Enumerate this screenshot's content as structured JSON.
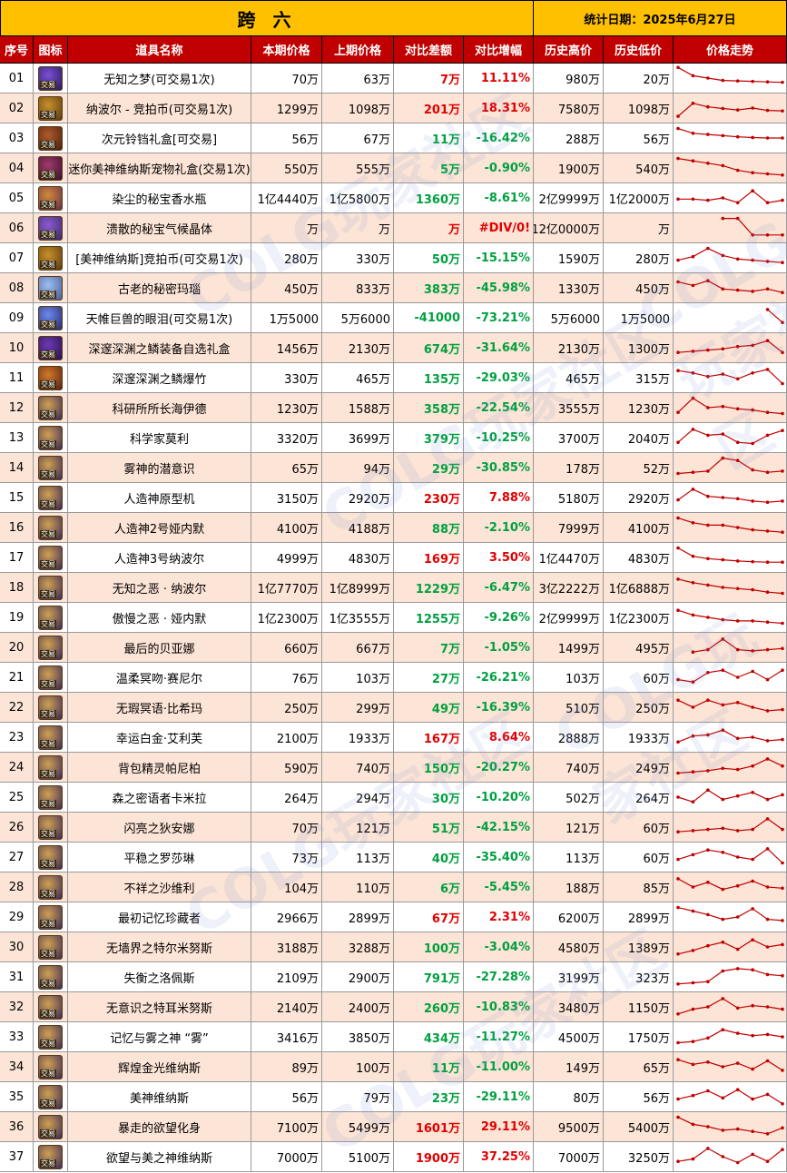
{
  "title": "跨 六",
  "stat_date": "统计日期：2025年6月27日",
  "columns": [
    "序号",
    "图标",
    "道具名称",
    "本期价格",
    "上期价格",
    "对比差额",
    "对比增幅",
    "历史高价",
    "历史低价",
    "价格走势"
  ],
  "watermark": "COLG玩家社区",
  "colors": {
    "header_yellow": "#ffc000",
    "header_red": "#c00000",
    "row_alt": "#fce4d6",
    "positive": "#e00000",
    "negative": "#00a040",
    "trend": "#c00000"
  },
  "rows": [
    {
      "no": "01",
      "icon": "purple-orb",
      "name": "无知之梦(可交易1次)",
      "cur": "70万",
      "prev": "63万",
      "diff": "7万",
      "pct": "11.11%",
      "hi": "980万",
      "lo": "20万",
      "dir": "pos",
      "trend": [
        95,
        60,
        50,
        40,
        38,
        36,
        34,
        32
      ]
    },
    {
      "no": "02",
      "icon": "gold-coin",
      "name": "纳波尔 - 竞拍币(可交易1次)",
      "cur": "1299万",
      "prev": "1098万",
      "diff": "201万",
      "pct": "18.31%",
      "hi": "7580万",
      "lo": "1098万",
      "dir": "pos",
      "trend": [
        15,
        70,
        55,
        48,
        42,
        50,
        40,
        38
      ]
    },
    {
      "no": "03",
      "icon": "treasure-box",
      "name": "次元铃铛礼盒[可交易]",
      "cur": "56万",
      "prev": "67万",
      "diff": "11万",
      "pct": "-16.42%",
      "hi": "288万",
      "lo": "56万",
      "dir": "neg",
      "trend": [
        90,
        70,
        65,
        60,
        55,
        52,
        50,
        50
      ]
    },
    {
      "no": "04",
      "icon": "pet-box",
      "name": "迷你美神维纳斯宠物礼盒(交易1次)",
      "cur": "550万",
      "prev": "555万",
      "diff": "5万",
      "pct": "-0.90%",
      "hi": "1900万",
      "lo": "540万",
      "dir": "neg",
      "trend": [
        90,
        80,
        70,
        60,
        40,
        30,
        25,
        20
      ]
    },
    {
      "no": "05",
      "icon": "perfume",
      "name": "染尘的秘宝香水瓶",
      "cur": "1亿4440万",
      "prev": "1亿5800万",
      "diff": "1360万",
      "pct": "-8.61%",
      "hi": "2亿9999万",
      "lo": "1亿2000万",
      "dir": "neg",
      "trend": [
        45,
        45,
        40,
        50,
        30,
        80,
        30,
        40
      ]
    },
    {
      "no": "06",
      "icon": "crystal",
      "name": "溃散的秘宝气候晶体",
      "cur": "万",
      "prev": "万",
      "diff": "万",
      "pct": "#DIV/0!",
      "hi": "12亿0000万",
      "lo": "万",
      "dir": "pos",
      "trend": [
        null,
        null,
        null,
        90,
        90,
        20,
        20,
        20
      ]
    },
    {
      "no": "07",
      "icon": "gold-coin",
      "name": "[美神维纳斯]竞拍币(可交易1次)",
      "cur": "280万",
      "prev": "330万",
      "diff": "50万",
      "pct": "-15.15%",
      "hi": "1590万",
      "lo": "280万",
      "dir": "neg",
      "trend": [
        40,
        55,
        90,
        60,
        45,
        40,
        35,
        30
      ]
    },
    {
      "no": "08",
      "icon": "agate",
      "name": "古老的秘密玛瑙",
      "cur": "450万",
      "prev": "833万",
      "diff": "383万",
      "pct": "-45.98%",
      "hi": "1330万",
      "lo": "450万",
      "dir": "neg",
      "trend": [
        75,
        60,
        80,
        45,
        40,
        35,
        45,
        30
      ]
    },
    {
      "no": "09",
      "icon": "eye-gem",
      "name": "天帷巨兽的眼泪(可交易1次)",
      "cur": "1万5000",
      "prev": "5万6000",
      "diff": "-41000",
      "pct": "-73.21%",
      "hi": "5万6000",
      "lo": "1万5000",
      "dir": "neg",
      "trend": [
        null,
        null,
        null,
        null,
        null,
        null,
        85,
        30
      ]
    },
    {
      "no": "10",
      "icon": "abyss-box",
      "name": "深邃深渊之鳞装备自选礼盒",
      "cur": "1456万",
      "prev": "2130万",
      "diff": "674万",
      "pct": "-31.64%",
      "hi": "2130万",
      "lo": "1300万",
      "dir": "neg",
      "trend": [
        30,
        35,
        40,
        45,
        55,
        60,
        80,
        30
      ]
    },
    {
      "no": "11",
      "icon": "firecracker",
      "name": "深邃深渊之鳞爆竹",
      "cur": "330万",
      "prev": "465万",
      "diff": "135万",
      "pct": "-29.03%",
      "hi": "465万",
      "lo": "315万",
      "dir": "neg",
      "trend": [
        80,
        70,
        55,
        65,
        45,
        70,
        85,
        25
      ]
    },
    {
      "no": "12",
      "icon": "card",
      "name": "科研所所长海伊德",
      "cur": "1230万",
      "prev": "1588万",
      "diff": "358万",
      "pct": "-22.54%",
      "hi": "3555万",
      "lo": "1230万",
      "dir": "neg",
      "trend": [
        30,
        90,
        50,
        55,
        45,
        40,
        30,
        25
      ]
    },
    {
      "no": "13",
      "icon": "card",
      "name": "科学家莫利",
      "cur": "3320万",
      "prev": "3699万",
      "diff": "379万",
      "pct": "-10.25%",
      "hi": "3700万",
      "lo": "2040万",
      "dir": "neg",
      "trend": [
        30,
        85,
        60,
        65,
        30,
        25,
        60,
        80
      ]
    },
    {
      "no": "14",
      "icon": "card",
      "name": "雾神的潜意识",
      "cur": "65万",
      "prev": "94万",
      "diff": "29万",
      "pct": "-30.85%",
      "hi": "178万",
      "lo": "52万",
      "dir": "neg",
      "trend": [
        25,
        30,
        35,
        90,
        80,
        40,
        30,
        35
      ]
    },
    {
      "no": "15",
      "icon": "card",
      "name": "人造神原型机",
      "cur": "3150万",
      "prev": "2920万",
      "diff": "230万",
      "pct": "7.88%",
      "hi": "5180万",
      "lo": "2920万",
      "dir": "pos",
      "trend": [
        40,
        85,
        55,
        50,
        45,
        35,
        30,
        35
      ]
    },
    {
      "no": "16",
      "icon": "card",
      "name": "人造神2号娅内默",
      "cur": "4100万",
      "prev": "4188万",
      "diff": "88万",
      "pct": "-2.10%",
      "hi": "7999万",
      "lo": "4100万",
      "dir": "neg",
      "trend": [
        90,
        70,
        60,
        60,
        50,
        40,
        35,
        30
      ]
    },
    {
      "no": "17",
      "icon": "card",
      "name": "人造神3号纳波尔",
      "cur": "4999万",
      "prev": "4830万",
      "diff": "169万",
      "pct": "3.50%",
      "hi": "1亿4470万",
      "lo": "4830万",
      "dir": "pos",
      "trend": [
        90,
        55,
        45,
        40,
        35,
        32,
        30,
        30
      ]
    },
    {
      "no": "18",
      "icon": "card",
      "name": "无知之恶 · 纳波尔",
      "cur": "1亿7770万",
      "prev": "1亿8999万",
      "diff": "1229万",
      "pct": "-6.47%",
      "hi": "3亿2222万",
      "lo": "1亿6888万",
      "dir": "neg",
      "trend": [
        85,
        70,
        60,
        50,
        45,
        40,
        30,
        25
      ]
    },
    {
      "no": "19",
      "icon": "card",
      "name": "傲慢之恶 · 娅内默",
      "cur": "1亿2300万",
      "prev": "1亿3555万",
      "diff": "1255万",
      "pct": "-9.26%",
      "hi": "2亿9999万",
      "lo": "1亿2300万",
      "dir": "neg",
      "trend": [
        80,
        60,
        50,
        40,
        35,
        35,
        30,
        25
      ]
    },
    {
      "no": "20",
      "icon": "card",
      "name": "最后的贝亚娜",
      "cur": "660万",
      "prev": "667万",
      "diff": "7万",
      "pct": "-1.05%",
      "hi": "1499万",
      "lo": "495万",
      "dir": "neg",
      "trend": [
        null,
        30,
        40,
        85,
        40,
        35,
        40,
        45
      ]
    },
    {
      "no": "21",
      "icon": "card",
      "name": "温柔冥吻·赛尼尔",
      "cur": "76万",
      "prev": "103万",
      "diff": "27万",
      "pct": "-26.21%",
      "hi": "103万",
      "lo": "60万",
      "dir": "neg",
      "trend": [
        40,
        30,
        70,
        80,
        50,
        75,
        40,
        80
      ]
    },
    {
      "no": "22",
      "icon": "card",
      "name": "无瑕冥语·比希玛",
      "cur": "250万",
      "prev": "299万",
      "diff": "49万",
      "pct": "-16.39%",
      "hi": "510万",
      "lo": "250万",
      "dir": "neg",
      "trend": [
        80,
        50,
        80,
        60,
        70,
        50,
        35,
        40
      ]
    },
    {
      "no": "23",
      "icon": "card",
      "name": "幸运白金·艾利芙",
      "cur": "2100万",
      "prev": "1933万",
      "diff": "167万",
      "pct": "8.64%",
      "hi": "2888万",
      "lo": "1933万",
      "dir": "pos",
      "trend": [
        30,
        55,
        60,
        80,
        45,
        50,
        35,
        40
      ]
    },
    {
      "no": "24",
      "icon": "card",
      "name": "背包精灵帕尼柏",
      "cur": "590万",
      "prev": "740万",
      "diff": "150万",
      "pct": "-20.27%",
      "hi": "740万",
      "lo": "249万",
      "dir": "neg",
      "trend": [
        25,
        30,
        35,
        45,
        40,
        55,
        85,
        55
      ]
    },
    {
      "no": "25",
      "icon": "card",
      "name": "森之密语者卡米拉",
      "cur": "264万",
      "prev": "294万",
      "diff": "30万",
      "pct": "-10.20%",
      "hi": "502万",
      "lo": "264万",
      "dir": "neg",
      "trend": [
        50,
        30,
        80,
        40,
        55,
        70,
        40,
        60
      ]
    },
    {
      "no": "26",
      "icon": "card",
      "name": "闪亮之狄安娜",
      "cur": "70万",
      "prev": "121万",
      "diff": "51万",
      "pct": "-42.15%",
      "hi": "121万",
      "lo": "60万",
      "dir": "neg",
      "trend": [
        30,
        35,
        40,
        45,
        35,
        40,
        85,
        40
      ]
    },
    {
      "no": "27",
      "icon": "card",
      "name": "平稳之罗莎琳",
      "cur": "73万",
      "prev": "113万",
      "diff": "40万",
      "pct": "-35.40%",
      "hi": "113万",
      "lo": "60万",
      "dir": "neg",
      "trend": [
        40,
        60,
        80,
        70,
        50,
        40,
        85,
        25
      ]
    },
    {
      "no": "28",
      "icon": "card",
      "name": "不祥之沙维利",
      "cur": "104万",
      "prev": "110万",
      "diff": "6万",
      "pct": "-5.45%",
      "hi": "188万",
      "lo": "85万",
      "dir": "neg",
      "trend": [
        85,
        50,
        70,
        40,
        55,
        75,
        50,
        45
      ]
    },
    {
      "no": "29",
      "icon": "card",
      "name": "最初记忆珍藏者",
      "cur": "2966万",
      "prev": "2899万",
      "diff": "67万",
      "pct": "2.31%",
      "hi": "6200万",
      "lo": "2899万",
      "dir": "pos",
      "trend": [
        90,
        75,
        60,
        40,
        50,
        85,
        40,
        35
      ]
    },
    {
      "no": "30",
      "icon": "card",
      "name": "无墙界之特尔米努斯",
      "cur": "3188万",
      "prev": "3288万",
      "diff": "100万",
      "pct": "-3.04%",
      "hi": "4580万",
      "lo": "1389万",
      "dir": "neg",
      "trend": [
        20,
        35,
        55,
        70,
        40,
        80,
        50,
        60
      ]
    },
    {
      "no": "31",
      "icon": "card",
      "name": "失衡之洛佩斯",
      "cur": "2109万",
      "prev": "2900万",
      "diff": "791万",
      "pct": "-27.28%",
      "hi": "3199万",
      "lo": "323万",
      "dir": "neg",
      "trend": [
        20,
        25,
        30,
        75,
        85,
        80,
        60,
        55
      ]
    },
    {
      "no": "32",
      "icon": "card",
      "name": "无意识之特耳米努斯",
      "cur": "2140万",
      "prev": "2400万",
      "diff": "260万",
      "pct": "-10.83%",
      "hi": "3480万",
      "lo": "1150万",
      "dir": "neg",
      "trend": [
        20,
        40,
        50,
        85,
        45,
        55,
        50,
        40
      ]
    },
    {
      "no": "33",
      "icon": "card",
      "name": "记忆与雾之神 “雾”",
      "cur": "3416万",
      "prev": "3850万",
      "diff": "434万",
      "pct": "-11.27%",
      "hi": "4500万",
      "lo": "1750万",
      "dir": "neg",
      "trend": [
        25,
        30,
        45,
        80,
        65,
        55,
        60,
        50
      ]
    },
    {
      "no": "34",
      "icon": "card",
      "name": "辉煌金光维纳斯",
      "cur": "89万",
      "prev": "100万",
      "diff": "11万",
      "pct": "-11.00%",
      "hi": "149万",
      "lo": "65万",
      "dir": "neg",
      "trend": [
        80,
        60,
        70,
        50,
        65,
        40,
        75,
        35
      ]
    },
    {
      "no": "35",
      "icon": "card",
      "name": "美神维纳斯",
      "cur": "56万",
      "prev": "79万",
      "diff": "23万",
      "pct": "-29.11%",
      "hi": "80万",
      "lo": "56万",
      "dir": "neg",
      "trend": [
        40,
        55,
        75,
        45,
        80,
        40,
        60,
        20
      ]
    },
    {
      "no": "36",
      "icon": "card",
      "name": "暴走的欲望化身",
      "cur": "7100万",
      "prev": "5499万",
      "diff": "1601万",
      "pct": "29.11%",
      "hi": "9500万",
      "lo": "5400万",
      "dir": "pos",
      "trend": [
        90,
        60,
        50,
        35,
        40,
        30,
        20,
        45
      ]
    },
    {
      "no": "37",
      "icon": "card",
      "name": "欲望与美之神维纳斯",
      "cur": "7000万",
      "prev": "5100万",
      "diff": "1900万",
      "pct": "37.25%",
      "hi": "7000万",
      "lo": "3250万",
      "dir": "pos",
      "trend": [
        30,
        40,
        85,
        50,
        25,
        60,
        30,
        80
      ]
    }
  ]
}
